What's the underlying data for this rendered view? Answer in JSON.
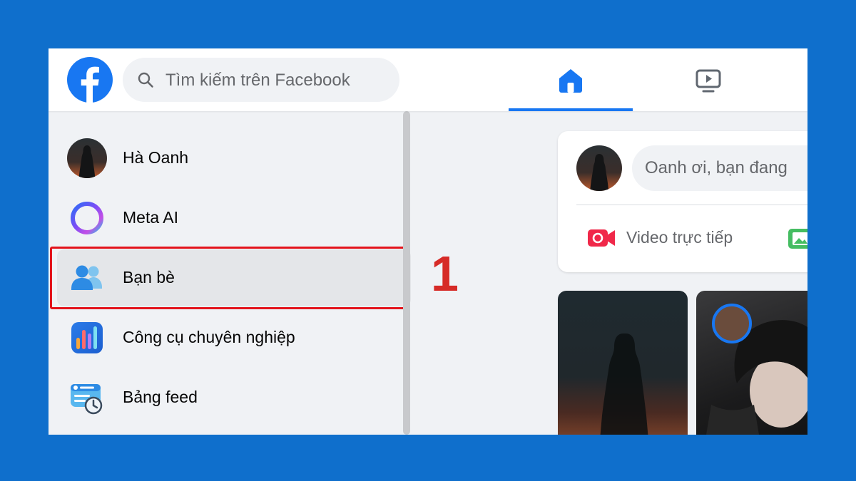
{
  "search": {
    "placeholder": "Tìm kiếm trên Facebook"
  },
  "nav": {
    "active_tab": "home"
  },
  "sidebar": {
    "items": [
      {
        "label": "Hà Oanh",
        "icon": "profile-avatar"
      },
      {
        "label": "Meta AI",
        "icon": "meta-ai-icon"
      },
      {
        "label": "Bạn bè",
        "icon": "friends-icon",
        "active": true
      },
      {
        "label": "Công cụ chuyên nghiệp",
        "icon": "professional-tools-icon"
      },
      {
        "label": "Bảng feed",
        "icon": "feeds-icon"
      }
    ]
  },
  "annotation": {
    "step": "1",
    "color": "#e3141c"
  },
  "composer": {
    "prompt": "Oanh ơi, bạn đang",
    "live_video_label": "Video trực tiếp"
  },
  "colors": {
    "brand": "#1877f2",
    "page_bg": "#0f6fcc",
    "annotation": "#d62b27"
  }
}
